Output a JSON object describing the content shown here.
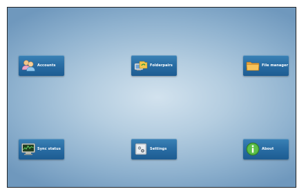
{
  "launcher": {
    "tiles": [
      {
        "label": "Accounts",
        "icon": "people-icon"
      },
      {
        "label": "Folderpairs",
        "icon": "folder-sync-icon"
      },
      {
        "label": "File manager",
        "icon": "folder-icon"
      },
      {
        "label": "Sync status",
        "icon": "monitor-chart-icon"
      },
      {
        "label": "Settings",
        "icon": "settings-icon"
      },
      {
        "label": "About",
        "icon": "info-icon"
      }
    ]
  },
  "colors": {
    "frame": "#1f2327",
    "tile": "#2a6ea5",
    "background_center": "#d2e2ee",
    "background_edge": "#6f98bd"
  }
}
